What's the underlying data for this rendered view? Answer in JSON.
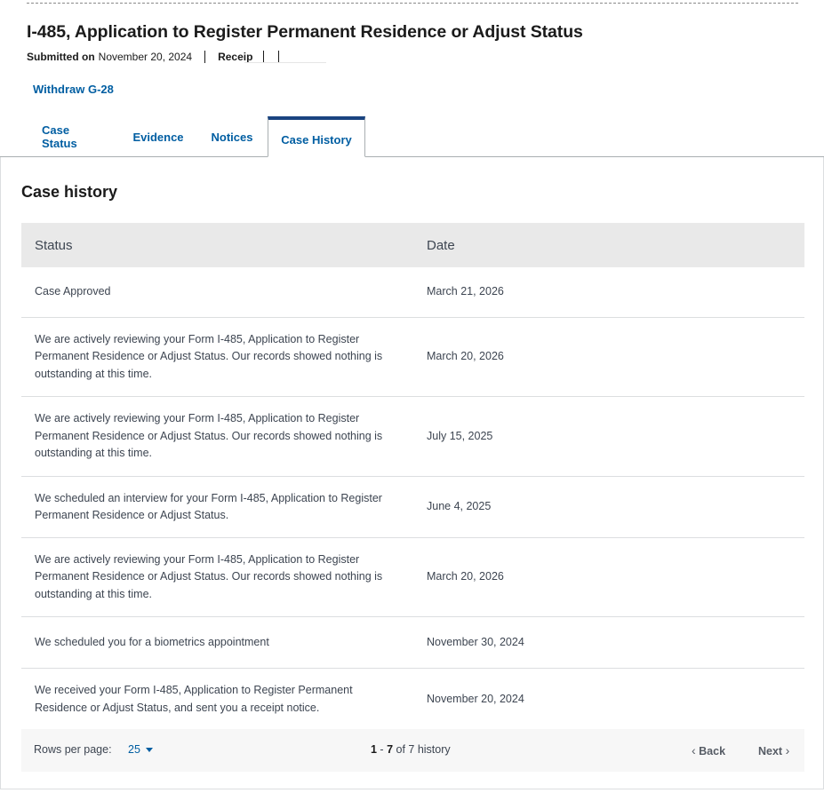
{
  "header": {
    "title": "I-485, Application to Register Permanent Residence or Adjust Status",
    "submitted_label": "Submitted on",
    "submitted_date": "November 20, 2024",
    "receipt_label": "Receip"
  },
  "actions": {
    "withdraw_label": "Withdraw G-28"
  },
  "tabs": [
    {
      "label": "Case Status"
    },
    {
      "label": "Evidence"
    },
    {
      "label": "Notices"
    },
    {
      "label": "Case History",
      "active": true
    }
  ],
  "history": {
    "title": "Case history",
    "columns": [
      "Status",
      "Date"
    ],
    "rows": [
      {
        "status": "Case Approved",
        "date": "March 21, 2026"
      },
      {
        "status": "We are actively reviewing your Form I-485, Application to Register Permanent Residence or Adjust Status. Our records showed nothing is outstanding at this time.",
        "date": "March 20, 2026"
      },
      {
        "status": "We are actively reviewing your Form I-485, Application to Register Permanent Residence or Adjust Status. Our records showed nothing is outstanding at this time.",
        "date": "July 15, 2025"
      },
      {
        "status": "We scheduled an interview for your Form I-485, Application to Register Permanent Residence or Adjust Status.",
        "date": "June 4, 2025"
      },
      {
        "status": "We are actively reviewing your Form I-485, Application to Register Permanent Residence or Adjust Status. Our records showed nothing is outstanding at this time.",
        "date": "March 20, 2026"
      },
      {
        "status": "We scheduled you for a biometrics appointment",
        "date": "November 30, 2024"
      },
      {
        "status": "We received your Form I-485, Application to Register Permanent Residence or Adjust Status, and sent you a receipt notice.",
        "date": "November 20, 2024"
      }
    ]
  },
  "pagination": {
    "rows_per_page_label": "Rows per page:",
    "rows_per_page_value": "25",
    "range_start": "1",
    "range_end": "7",
    "range_total_text": "of 7 history",
    "back_label": "Back",
    "next_label": "Next",
    "icons": {
      "dropdown": "caret-down-icon",
      "back": "chevron-left-icon",
      "next": "chevron-right-icon"
    }
  },
  "colors": {
    "link": "#005ea2",
    "active_tab": "#1a4480",
    "header_bg": "#e9e9e9",
    "text": "#3d4551"
  }
}
